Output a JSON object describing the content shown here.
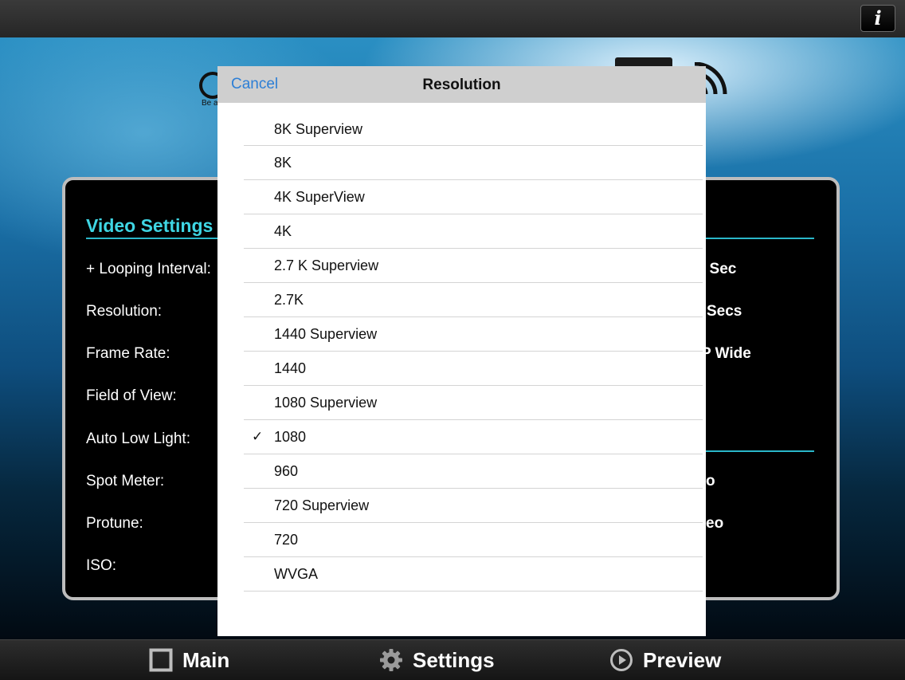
{
  "topbar": {
    "info_label": "i"
  },
  "brand": {
    "tagline": "Be a"
  },
  "panel": {
    "title": "Video Settings",
    "labels": [
      "+ Looping Interval:",
      "Resolution:",
      "Frame Rate:",
      "Field of View:",
      "Auto Low Light:",
      "Spot Meter:",
      "Protune:",
      "ISO:"
    ],
    "values": [
      "/ Sec",
      "Secs",
      "P Wide",
      "o",
      "eo"
    ]
  },
  "popover": {
    "cancel_label": "Cancel",
    "title": "Resolution",
    "check_mark": "✓",
    "options": [
      {
        "label": "8K Superview"
      },
      {
        "label": "8K"
      },
      {
        "label": "4K SuperView"
      },
      {
        "label": "4K"
      },
      {
        "label": "2.7 K Superview"
      },
      {
        "label": "2.7K"
      },
      {
        "label": "1440 Superview"
      },
      {
        "label": "1440"
      },
      {
        "label": "1080 Superview"
      },
      {
        "label": "1080",
        "selected": true
      },
      {
        "label": "960"
      },
      {
        "label": "720 Superview"
      },
      {
        "label": "720"
      },
      {
        "label": "WVGA"
      }
    ]
  },
  "tabs": {
    "main": "Main",
    "settings": "Settings",
    "preview": "Preview"
  },
  "colors": {
    "accent_cyan": "#3fd6e4",
    "link_blue": "#2d7fd6"
  }
}
